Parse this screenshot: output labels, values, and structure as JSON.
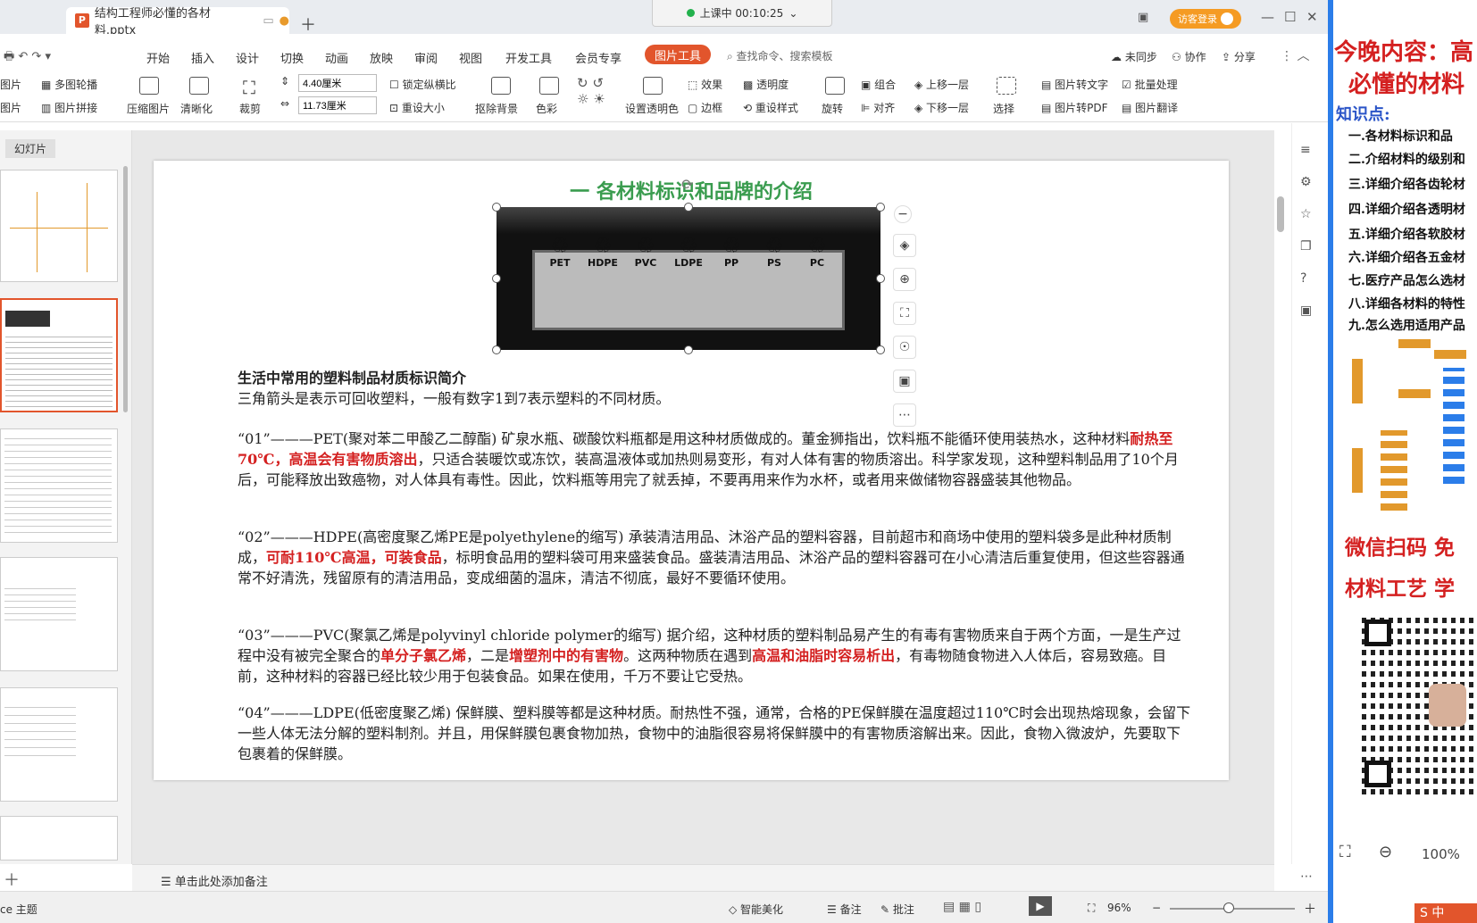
{
  "window": {
    "tab_title": "结构工程师必懂的各材料.pptx",
    "timer": "上课中 00:10:25",
    "login": "访客登录"
  },
  "menu": [
    "开始",
    "插入",
    "设计",
    "切换",
    "动画",
    "放映",
    "审阅",
    "视图",
    "开发工具",
    "会员专享"
  ],
  "active_tab": "图片工具",
  "search_placeholder": "查找命令、搜索模板",
  "top_right": {
    "sync": "未同步",
    "collab": "协作",
    "share": "分享"
  },
  "ribbon": {
    "pic": "图片",
    "multi": "多图轮播",
    "pic2": "图片",
    "splice": "图片拼接",
    "compress": "压缩图片",
    "clarity": "清晰化",
    "crop": "裁剪",
    "height": "4.40厘米",
    "width": "11.73厘米",
    "lock": "锁定纵横比",
    "resize": "重设大小",
    "remove_bg": "抠除背景",
    "color": "色彩",
    "transparent": "设置透明色",
    "effect": "效果",
    "transparency": "透明度",
    "border": "边框",
    "reset_style": "重设样式",
    "rotate": "旋转",
    "group": "组合",
    "align": "对齐",
    "up": "上移一层",
    "down": "下移一层",
    "select": "选择",
    "to_text": "图片转文字",
    "batch": "批量处理",
    "to_pdf": "图片转PDF",
    "translate": "图片翻译"
  },
  "panel_label": "幻灯片",
  "slide": {
    "title": "一  各材料标识和品牌的介绍",
    "labels": [
      "PET",
      "HDPE",
      "PVC",
      "LDPE",
      "PP",
      "PS",
      "PC"
    ],
    "subtitle": "生活中常用的塑料制品材质标识简介",
    "intro": "三角箭头是表示可回收塑料，一般有数字1到7表示塑料的不同材质。",
    "p1a": "“01”———PET(聚对苯二甲酸乙二醇酯) 矿泉水瓶、碳酸饮料瓶都是用这种材质做成的。董金狮指出，饮料瓶不能循环使用装热水，这种材料",
    "p1r": "耐热至70℃，高温会有害物质溶出",
    "p1b": "，只适合装暖饮或冻饮，装高温液体或加热则易变形，有对人体有害的物质溶出。科学家发现，这种塑料制品用了10个月后，可能释放出致癌物，对人体具有毒性。因此，饮料瓶等用完了就丢掉，不要再用来作为水杯，或者用来做储物容器盛装其他物品。",
    "p2a": "“02”———HDPE(高密度聚乙烯PE是polyethylene的缩写) 承装清洁用品、沐浴产品的塑料容器，目前超市和商场中使用的塑料袋多是此种材质制成，",
    "p2r": "可耐110℃高温，可装食品",
    "p2b": "，标明食品用的塑料袋可用来盛装食品。盛装清洁用品、沐浴产品的塑料容器可在小心清洁后重复使用，但这些容器通常不好清洗，残留原有的清洁用品，变成细菌的温床，清洁不彻底，最好不要循环使用。",
    "p3a": "“03”———PVC(聚氯乙烯是polyvinyl chloride polymer的缩写) 据介绍，这种材质的塑料制品易产生的有毒有害物质来自于两个方面，一是生产过程中没有被完全聚合的",
    "p3r1": "单分子氯乙烯",
    "p3b": "，二是",
    "p3r2": "增塑剂中的有害物",
    "p3c": "。这两种物质在遇到",
    "p3r3": "高温和油脂时容易析出",
    "p3d": "，有毒物随食物进入人体后，容易致癌。目前，这种材料的容器已经比较少用于包装食品。如果在使用，千万不要让它受热。",
    "p4": "“04”———LDPE(低密度聚乙烯) 保鲜膜、塑料膜等都是这种材质。耐热性不强，通常，合格的PE保鲜膜在温度超过110℃时会出现热熔现象，会留下一些人体无法分解的塑料制剂。并且，用保鲜膜包裹食物加热，食物中的油脂很容易将保鲜膜中的有害物质溶解出来。因此，食物入微波炉，先要取下包裹着的保鲜膜。"
  },
  "notes": "单击此处添加备注",
  "status": {
    "theme": "ce 主题",
    "beautify": "智能美化",
    "remarks": "备注",
    "comment": "批注",
    "zoom": "96%"
  },
  "preview": {
    "title1": "今晚内容：高",
    "title2": "必懂的材料",
    "kp": "知识点:",
    "items": [
      "一.各材料标识和品",
      "二.介绍材料的级别和",
      "三.详细介绍各齿轮材",
      "四.详细介绍各透明材",
      "五.详细介绍各软胶材",
      "六.详细介绍各五金材",
      "七.医疗产品怎么选材",
      "八.详细各材料的特性",
      "九.怎么选用适用产品"
    ],
    "promo1": "微信扫码 免",
    "promo2": "材料工艺 学",
    "zoom": "100%"
  }
}
